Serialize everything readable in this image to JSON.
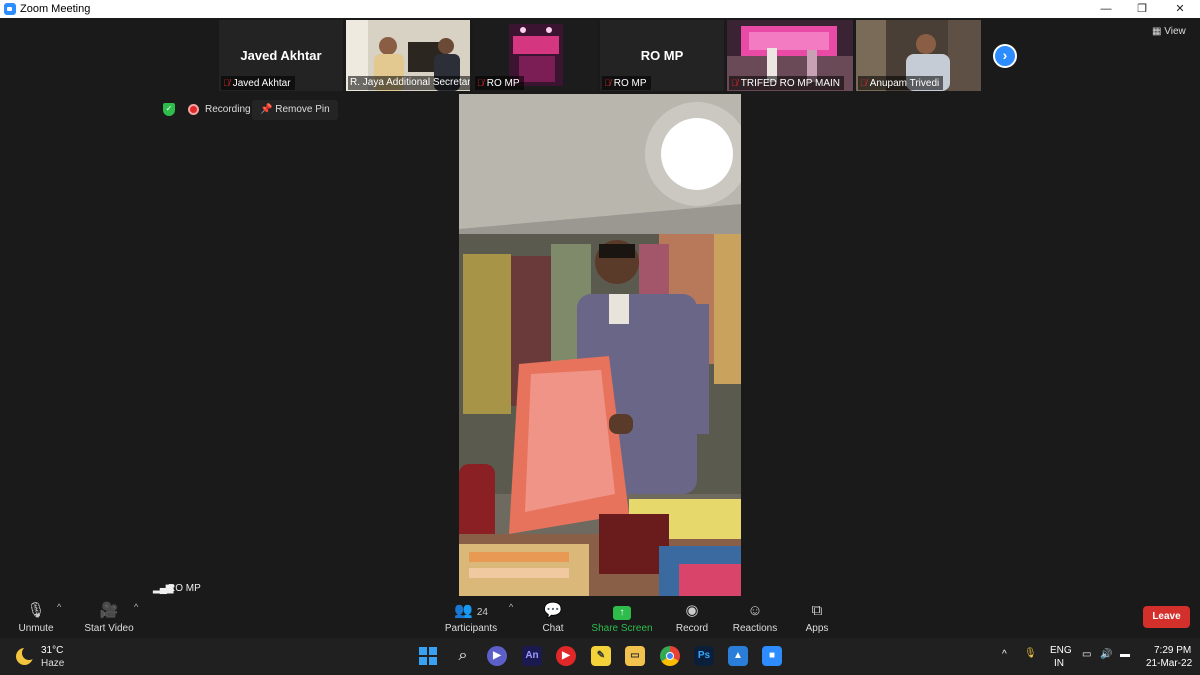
{
  "window": {
    "title": "Zoom Meeting",
    "controls": {
      "minimize": "—",
      "restore": "❐",
      "close": "✕"
    }
  },
  "thumbnails": [
    {
      "big_name": "Javed Akhtar",
      "label": "Javed Akhtar"
    },
    {
      "big_name": "",
      "label": "R. Jaya Additional Secretary"
    },
    {
      "big_name": "",
      "label": "RO MP"
    },
    {
      "big_name": "RO MP",
      "label": "RO MP"
    },
    {
      "big_name": "",
      "label": "TRIFED RO MP MAIN"
    },
    {
      "big_name": "",
      "label": "Anupam Trivedi"
    }
  ],
  "view_button": "View",
  "status": {
    "recording": "Recording",
    "remove_pin": "Remove Pin"
  },
  "main_video": {
    "speaker_label": "RO MP"
  },
  "toolbar": {
    "unmute": "Unmute",
    "start_video": "Start Video",
    "participants": "Participants",
    "participants_count": "24",
    "chat": "Chat",
    "share_screen": "Share Screen",
    "record": "Record",
    "reactions": "Reactions",
    "apps": "Apps",
    "leave": "Leave"
  },
  "colors": {
    "accent": "#2d8cff",
    "leave": "#d3302b",
    "share_green": "#2ebd4b",
    "muted_red": "#e02828"
  },
  "taskbar": {
    "weather_temp": "31°C",
    "weather_condition": "Haze",
    "apps": [
      "windows-start-icon",
      "search-icon",
      "teams-chat-icon",
      "animate-icon",
      "youtube-music-icon",
      "sticky-notes-icon",
      "file-explorer-icon",
      "chrome-icon",
      "photoshop-icon",
      "photos-icon",
      "zoom-icon"
    ],
    "app_labels": {
      "animate": "An",
      "photoshop": "Ps"
    },
    "language_line1": "ENG",
    "language_line2": "IN",
    "time": "7:29 PM",
    "date": "21-Mar-22"
  }
}
